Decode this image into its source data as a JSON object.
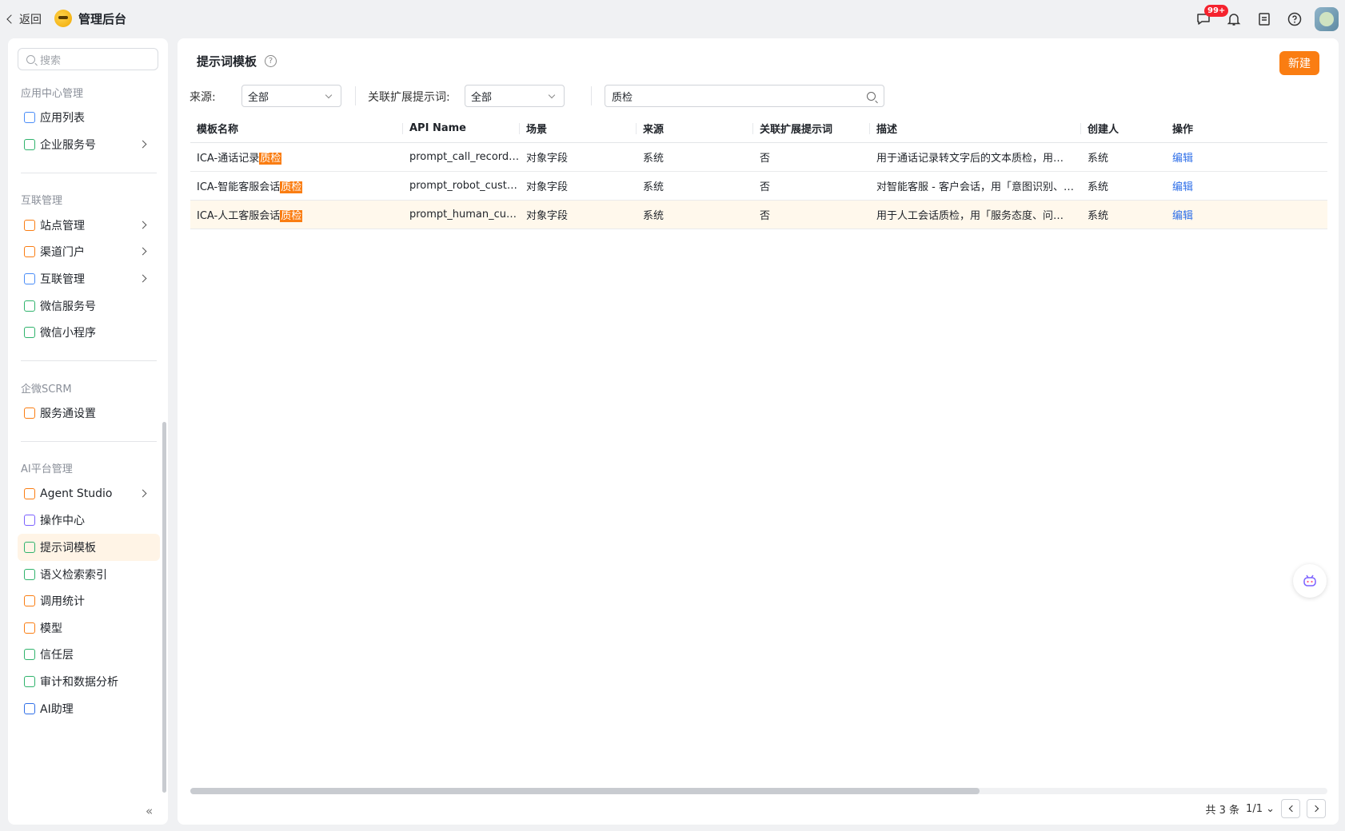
{
  "topbar": {
    "back_label": "返回",
    "app_title": "管理后台",
    "badge": "99+"
  },
  "sidebar": {
    "search_placeholder": "搜索",
    "sections": [
      {
        "title": "应用中心管理",
        "items": [
          {
            "label": "应用列表",
            "icon": "grid-icon",
            "arrow": false
          },
          {
            "label": "企业服务号",
            "icon": "bookmark-icon",
            "arrow": true
          }
        ]
      },
      {
        "title": "互联管理",
        "items": [
          {
            "label": "站点管理",
            "icon": "building-icon",
            "arrow": true
          },
          {
            "label": "渠道门户",
            "icon": "building-icon",
            "arrow": true
          },
          {
            "label": "互联管理",
            "icon": "link-circles-icon",
            "arrow": true
          },
          {
            "label": "微信服务号",
            "icon": "wechat-icon",
            "arrow": false
          },
          {
            "label": "微信小程序",
            "icon": "miniprogram-icon",
            "arrow": false
          }
        ]
      },
      {
        "title": "企微SCRM",
        "items": [
          {
            "label": "服务通设置",
            "icon": "settings-doc-icon",
            "arrow": false
          }
        ]
      },
      {
        "title": "AI平台管理",
        "items": [
          {
            "label": "Agent Studio",
            "icon": "robot-icon",
            "arrow": true
          },
          {
            "label": "操作中心",
            "icon": "calendar-icon",
            "arrow": false
          },
          {
            "label": "提示词模板",
            "icon": "template-icon",
            "arrow": false,
            "active": true
          },
          {
            "label": "语义检索索引",
            "icon": "book-icon",
            "arrow": false
          },
          {
            "label": "调用统计",
            "icon": "bar-chart-icon",
            "arrow": false
          },
          {
            "label": "模型",
            "icon": "model-grid-icon",
            "arrow": false
          },
          {
            "label": "信任层",
            "icon": "shield-icon",
            "arrow": false
          },
          {
            "label": "审计和数据分析",
            "icon": "window-icon",
            "arrow": false
          },
          {
            "label": "AI助理",
            "icon": "magic-wand-icon",
            "arrow": false
          }
        ]
      }
    ]
  },
  "main": {
    "title": "提示词模板",
    "new_button": "新建",
    "filters": {
      "source_label": "来源:",
      "source_value": "全部",
      "related_label": "关联扩展提示词:",
      "related_value": "全部",
      "keyword": "质检"
    },
    "table": {
      "columns": [
        "模板名称",
        "API Name",
        "场景",
        "来源",
        "关联扩展提示词",
        "描述",
        "创建人",
        "操作"
      ],
      "rows": [
        {
          "name_prefix": "ICA-通话记录",
          "name_hl": "质检",
          "api": "prompt_call_record…",
          "scene": "对象字段",
          "source": "系统",
          "related": "否",
          "desc": "用于通话记录转文字后的文本质检，用…",
          "creator": "系统",
          "action": "编辑"
        },
        {
          "name_prefix": "ICA-智能客服会话",
          "name_hl": "质检",
          "api": "prompt_robot_cust…",
          "scene": "对象字段",
          "source": "系统",
          "related": "否",
          "desc": "对智能客服 - 客户会话，用「意图识别、…",
          "creator": "系统",
          "action": "编辑"
        },
        {
          "name_prefix": "ICA-人工客服会话",
          "name_hl": "质检",
          "api": "prompt_human_cus…",
          "scene": "对象字段",
          "source": "系统",
          "related": "否",
          "desc": "用于人工会话质检，用「服务态度、问…",
          "creator": "系统",
          "action": "编辑"
        }
      ]
    },
    "pager": {
      "total": "共 3 条",
      "page": "1/1"
    }
  },
  "colors": {
    "accent": "#fa7d12",
    "link": "#2f6fe8",
    "highlight_row": "#fff8ec"
  }
}
